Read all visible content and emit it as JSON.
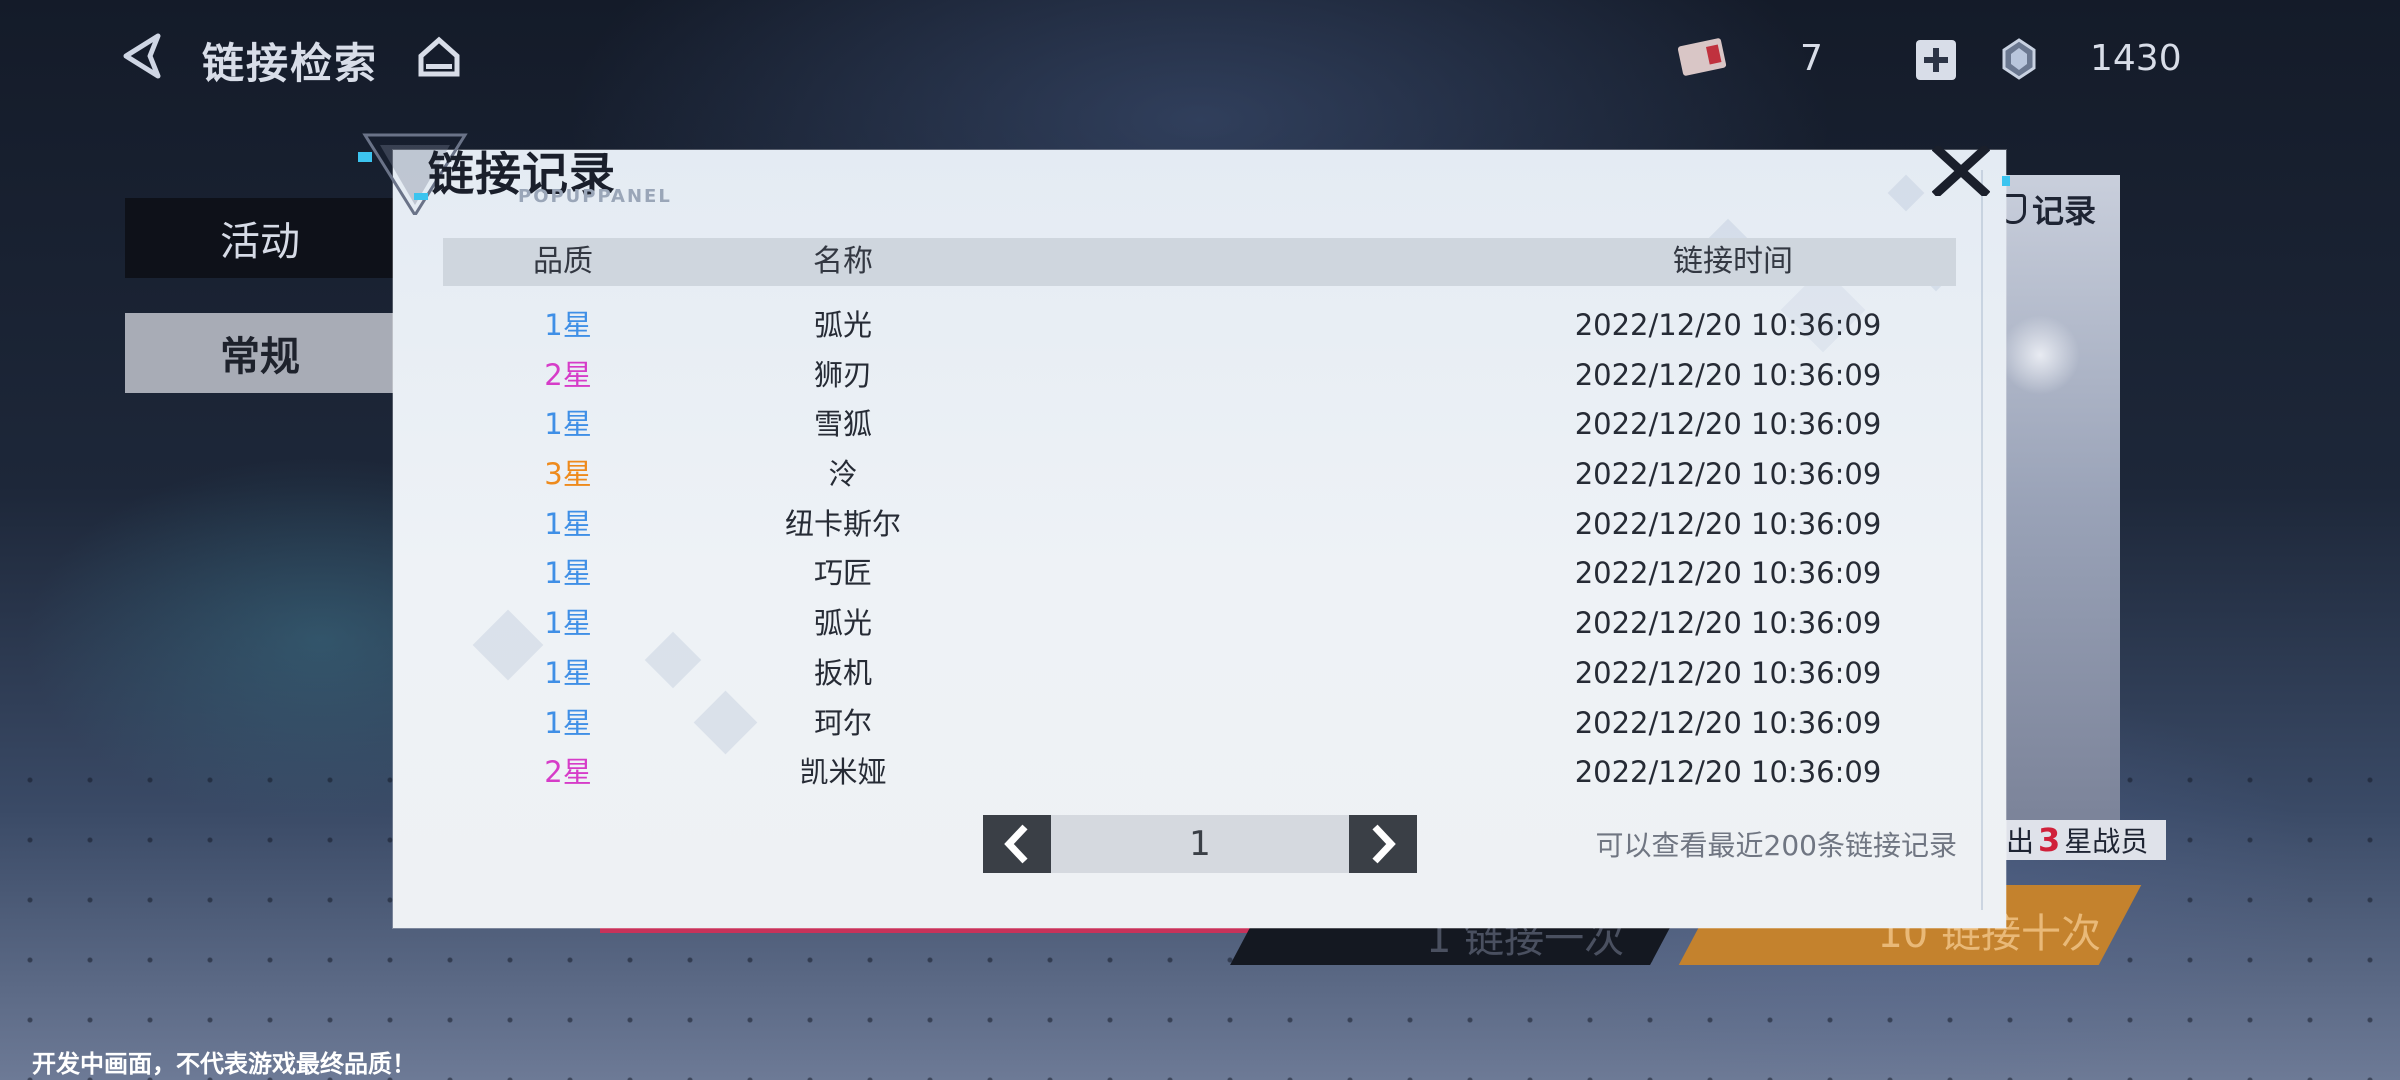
{
  "topbar": {
    "title": "链接检索",
    "ticket_count": "7",
    "crystal_count": "1430"
  },
  "tabs": [
    {
      "label": "活动",
      "selected": false
    },
    {
      "label": "常规",
      "selected": true
    }
  ],
  "background": {
    "record_label": "记录",
    "guarantee_prefix": "出",
    "guarantee_number": "3",
    "guarantee_suffix": "星战员",
    "link_once": "1 链接一次",
    "link_ten": "10 链接十次"
  },
  "modal": {
    "title": "链接记录",
    "subtitle": "POPUPPANEL",
    "headers": {
      "quality": "品质",
      "name": "名称",
      "time": "链接时间"
    },
    "rows": [
      {
        "quality": "1星",
        "name": "弧光",
        "time": "2022/12/20 10:36:09"
      },
      {
        "quality": "2星",
        "name": "狮刃",
        "time": "2022/12/20 10:36:09"
      },
      {
        "quality": "1星",
        "name": "雪狐",
        "time": "2022/12/20 10:36:09"
      },
      {
        "quality": "3星",
        "name": "泠",
        "time": "2022/12/20 10:36:09"
      },
      {
        "quality": "1星",
        "name": "纽卡斯尔",
        "time": "2022/12/20 10:36:09"
      },
      {
        "quality": "1星",
        "name": "巧匠",
        "time": "2022/12/20 10:36:09"
      },
      {
        "quality": "1星",
        "name": "弧光",
        "time": "2022/12/20 10:36:09"
      },
      {
        "quality": "1星",
        "name": "扳机",
        "time": "2022/12/20 10:36:09"
      },
      {
        "quality": "1星",
        "name": "珂尔",
        "time": "2022/12/20 10:36:09"
      },
      {
        "quality": "2星",
        "name": "凯米娅",
        "time": "2022/12/20 10:36:09"
      }
    ],
    "page": "1",
    "note": "可以查看最近200条链接记录"
  },
  "quality_colors": {
    "1星": "#3f8fe6",
    "2星": "#d63cc8",
    "3星": "#ee8a1c"
  },
  "footer_note": "开发中画面，不代表游戏最终品质！"
}
